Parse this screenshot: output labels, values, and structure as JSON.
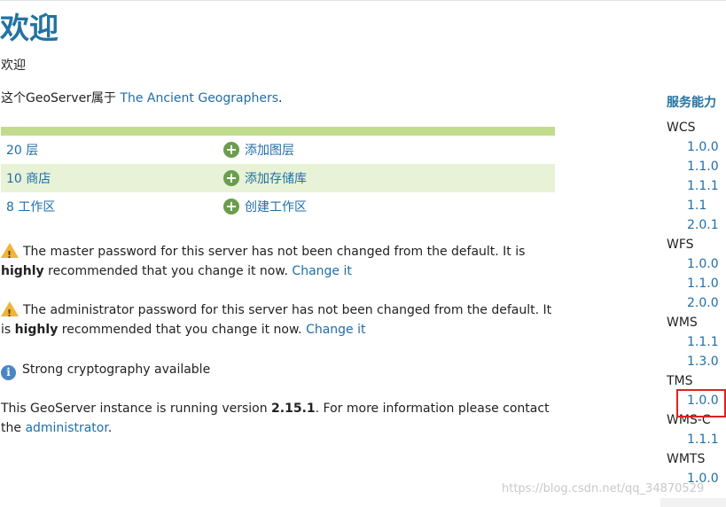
{
  "header": {
    "title": "欢迎",
    "subtitle": "欢迎"
  },
  "owner": {
    "prefix": "这个GeoServer属于 ",
    "name": "The Ancient Geographers",
    "suffix": "."
  },
  "summary": [
    {
      "count": "20 层",
      "action": "添加图层"
    },
    {
      "count": "10 商店",
      "action": "添加存储库"
    },
    {
      "count": "8 工作区",
      "action": "创建工作区"
    }
  ],
  "messages": {
    "master": {
      "text1": "The master password for this server has not been changed from the default. It is ",
      "bold": "highly",
      "text2": " recommended that you change it now. ",
      "link": "Change it"
    },
    "admin": {
      "text1": "The administrator password for this server has not been changed from the default. It is ",
      "bold": "highly",
      "text2": " recommended that you change it now. ",
      "link": "Change it"
    },
    "crypto": "Strong cryptography available",
    "version": {
      "text1": "This GeoServer instance is running version ",
      "version": "2.15.1",
      "text2": ". For more information please contact the ",
      "link": "administrator",
      "text3": "."
    }
  },
  "capabilities": {
    "heading": "服务能力",
    "services": [
      {
        "name": "WCS",
        "versions": [
          "1.0.0",
          "1.1.0",
          "1.1.1",
          "1.1",
          "2.0.1"
        ]
      },
      {
        "name": "WFS",
        "versions": [
          "1.0.0",
          "1.1.0",
          "2.0.0"
        ]
      },
      {
        "name": "WMS",
        "versions": [
          "1.1.1",
          "1.3.0"
        ]
      },
      {
        "name": "TMS",
        "versions": [
          "1.0.0"
        ]
      },
      {
        "name": "WMS-C",
        "versions": [
          "1.1.1"
        ]
      },
      {
        "name": "WMTS",
        "versions": [
          "1.0.0"
        ]
      }
    ]
  },
  "watermark": "https://blog.csdn.net/qq_34870529",
  "colors": {
    "accent": "#2173a3",
    "link": "#1f6ea8",
    "table_band": "#c2dc8e",
    "row_alt": "#e8f2d6",
    "add_icon": "#6a9d4c",
    "warning": "#f0b43c",
    "info": "#4a86c5",
    "highlight": "#e02020"
  }
}
